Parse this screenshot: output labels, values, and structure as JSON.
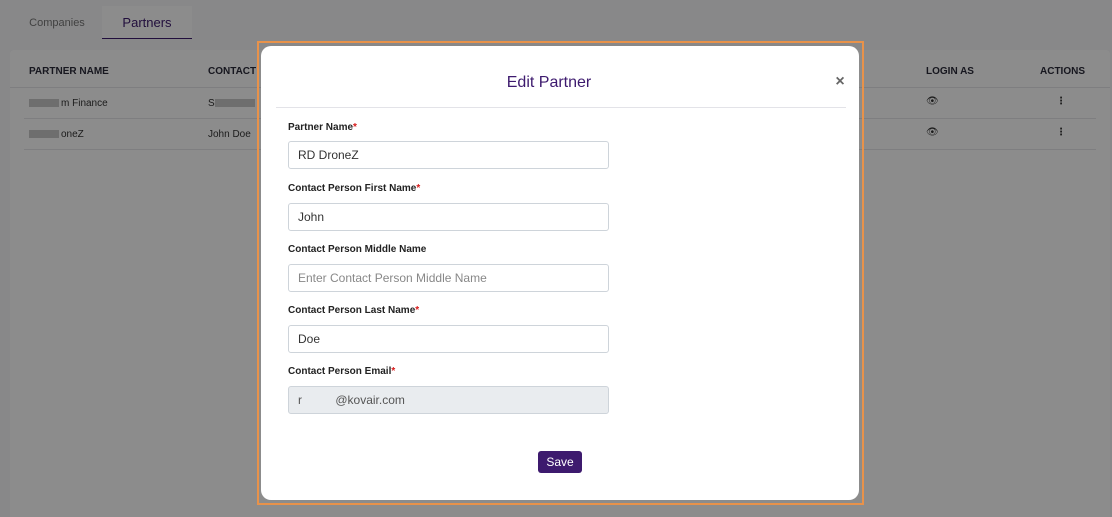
{
  "tabs": [
    {
      "label": "Companies"
    },
    {
      "label": "Partners"
    }
  ],
  "table": {
    "columns": [
      "PARTNER NAME",
      "CONTACT",
      "LOGIN AS",
      "ACTIONS"
    ],
    "rows": [
      {
        "partner": "m Finance",
        "contact": "S"
      },
      {
        "partner": "oneZ",
        "contact": "John Doe"
      }
    ]
  },
  "modal": {
    "title": "Edit Partner",
    "close_label": "×",
    "fields": [
      {
        "label": "Partner Name",
        "required": "*",
        "value": "RD DroneZ",
        "placeholder": ""
      },
      {
        "label": "Contact Person First Name",
        "required": "*",
        "value": "John",
        "placeholder": ""
      },
      {
        "label": "Contact Person Middle Name",
        "required": "",
        "value": "",
        "placeholder": "Enter Contact Person Middle Name"
      },
      {
        "label": "Contact Person Last Name",
        "required": "*",
        "value": "Doe",
        "placeholder": ""
      },
      {
        "label": "Contact Person Email",
        "required": "*",
        "value": "r          @kovair.com",
        "placeholder": ""
      }
    ],
    "save_label": "Save"
  },
  "icons": {
    "login": "eye-icon",
    "actions": "kebab-menu-icon",
    "close": "close-icon"
  },
  "colors": {
    "accent": "#3d1a6e",
    "required": "#d81b1b",
    "highlight": "#e8924a"
  }
}
